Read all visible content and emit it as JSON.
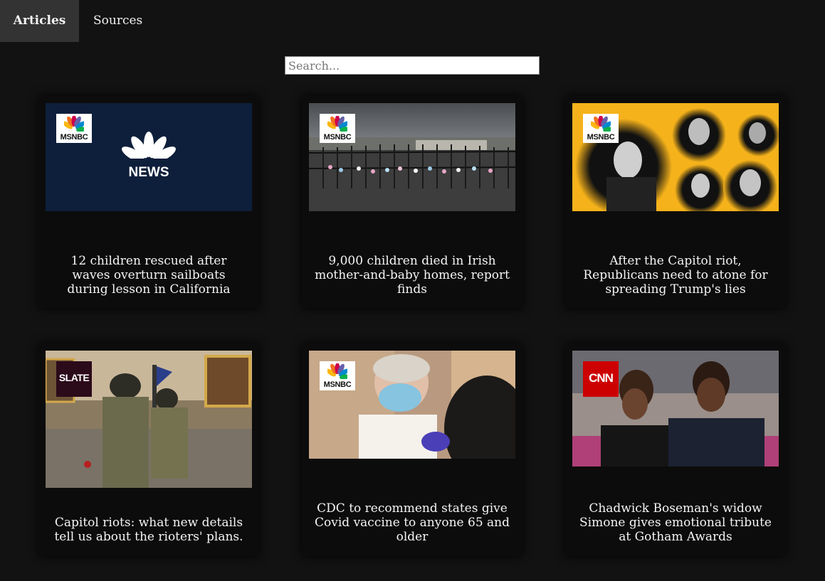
{
  "nav": {
    "tabs": [
      {
        "label": "Articles",
        "active": true
      },
      {
        "label": "Sources",
        "active": false
      }
    ]
  },
  "search": {
    "placeholder": "Search...",
    "value": ""
  },
  "articles": [
    {
      "title": "12 children rescued after waves overturn sailboats during lesson in California",
      "source": "MSNBC",
      "image_text": "NEWS"
    },
    {
      "title": "9,000 children died in Irish mother-and-baby homes, report finds",
      "source": "MSNBC"
    },
    {
      "title": "After the Capitol riot, Republicans need to atone for spreading Trump's lies",
      "source": "MSNBC"
    },
    {
      "title": "Capitol riots: what new details tell us about the rioters' plans.",
      "source": "SLATE"
    },
    {
      "title": "CDC to recommend states give Covid vaccine to anyone 65 and older",
      "source": "MSNBC"
    },
    {
      "title": "Chadwick Boseman's widow Simone gives emotional tribute at Gotham Awards",
      "source": "CNN"
    }
  ],
  "colors": {
    "background": "#121212",
    "card": "#0c0c0c",
    "active_tab": "#333333",
    "msnbc_tile": "#0e1f3b",
    "gop_tile": "#f5b21b",
    "cnn_red": "#cc0000",
    "slate_bg": "#2b0a1a"
  }
}
